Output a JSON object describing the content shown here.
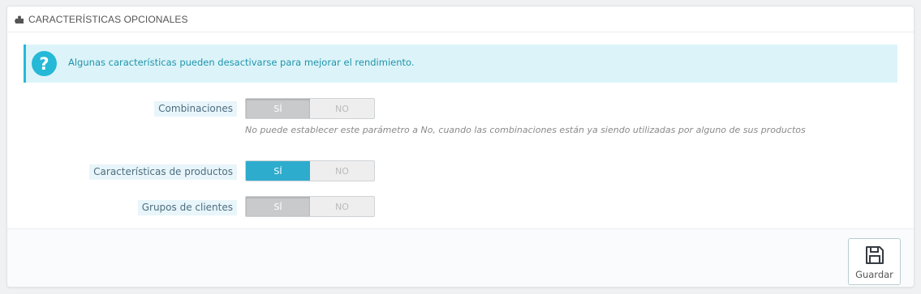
{
  "panel": {
    "title": "CARACTERÍSTICAS OPCIONALES",
    "title_icon": "puzzle-icon"
  },
  "alert": {
    "icon": "question-icon",
    "icon_glyph": "?",
    "message": "Algunas características pueden desactivarse para mejorar el rendimiento."
  },
  "options": [
    {
      "label": "Combinaciones",
      "yes": "SÍ",
      "no": "NO",
      "value": "SÍ",
      "disabled": true,
      "help": "No puede establecer este parámetro a No, cuando las combinaciones están ya siendo utilizadas por alguno de sus productos"
    },
    {
      "label": "Características de productos",
      "yes": "SÍ",
      "no": "NO",
      "value": "SÍ",
      "disabled": false
    },
    {
      "label": "Grupos de clientes",
      "yes": "SÍ",
      "no": "NO",
      "value": "SÍ",
      "disabled": true
    }
  ],
  "footer": {
    "save_label": "Guardar",
    "save_icon": "save-icon"
  },
  "colors": {
    "accent": "#25b9d7",
    "switch_on": "#2eacce",
    "alert_bg": "#dcf4f9",
    "alert_text": "#1e94ab"
  }
}
